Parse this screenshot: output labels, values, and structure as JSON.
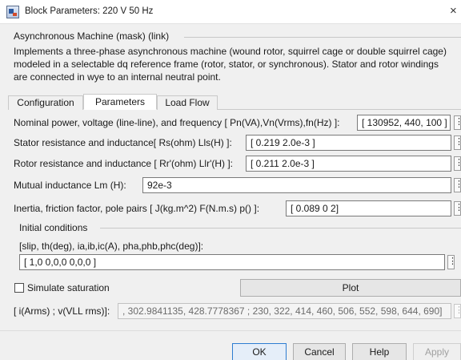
{
  "window": {
    "title": "Block Parameters: 220 V 50 Hz",
    "close_glyph": "×"
  },
  "block": {
    "group_title": "Asynchronous Machine (mask) (link)",
    "description_lines": [
      "Implements a three-phase asynchronous machine (wound rotor, squirrel cage or double squirrel cage)",
      "modeled in a selectable dq reference frame (rotor, stator, or synchronous). Stator and rotor windings",
      "are connected in wye to an internal neutral point."
    ]
  },
  "tabs": [
    {
      "label": "Configuration",
      "active": false
    },
    {
      "label": "Parameters",
      "active": true
    },
    {
      "label": "Load Flow",
      "active": false
    }
  ],
  "params": {
    "nominal": {
      "label": "Nominal power, voltage (line-line), and frequency [ Pn(VA),Vn(Vrms),fn(Hz) ]:",
      "value": "[ 130952, 440, 100 ]"
    },
    "stator": {
      "label": "Stator resistance and inductance[ Rs(ohm)  Lls(H) ]:",
      "value": "[ 0.219  2.0e-3 ]"
    },
    "rotor": {
      "label": "Rotor resistance and inductance [ Rr'(ohm)  Llr'(H) ]:",
      "value": "[ 0.211  2.0e-3 ]"
    },
    "mutual": {
      "label": "Mutual inductance Lm (H):",
      "value": "92e-3"
    },
    "inertia": {
      "label": "Inertia, friction factor, pole pairs [ J(kg.m^2)  F(N.m.s)  p() ]:",
      "value": "[ 0.089  0 2]"
    }
  },
  "initial_conditions": {
    "group_title": "Initial conditions",
    "label": "[slip, th(deg), ia,ib,ic(A), pha,phb,phc(deg)]:",
    "value": "[ 1,0  0,0,0  0,0,0 ]"
  },
  "saturation": {
    "checkbox_label": "Simulate saturation",
    "checked": false,
    "plot_label": "Plot",
    "data_label": "[ i(Arms) ; v(VLL rms)]:",
    "data_value": ", 302.9841135, 428.7778367 ; 230, 322, 414, 460, 506, 552, 598, 644, 690]"
  },
  "kebab_glyph": "⋮",
  "buttons": {
    "ok": "OK",
    "cancel": "Cancel",
    "help": "Help",
    "apply": "Apply"
  },
  "colors": {
    "background": "#f0f0f0",
    "field_border": "#7a7a7a",
    "default_button_border": "#2e7dd1"
  }
}
